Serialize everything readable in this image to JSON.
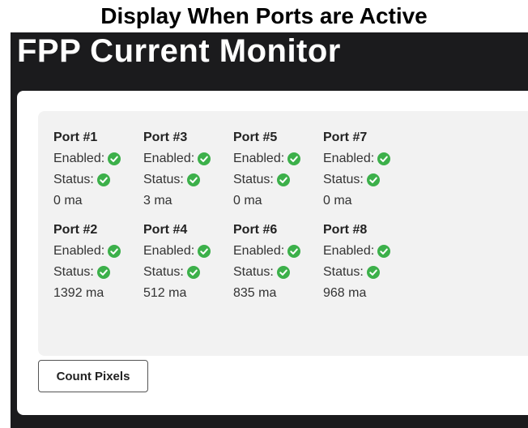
{
  "caption": "Display When Ports are Active",
  "app": {
    "title": "FPP Current Monitor"
  },
  "labels": {
    "enabled": "Enabled:",
    "status": "Status:"
  },
  "colors": {
    "check": "#3cb04a",
    "background": "#1b1b1d"
  },
  "icons": {
    "enabled": "check-circle-icon",
    "status": "check-circle-icon"
  },
  "ports": [
    {
      "name": "Port #1",
      "enabled": true,
      "status_ok": true,
      "current": "0 ma"
    },
    {
      "name": "Port #3",
      "enabled": true,
      "status_ok": true,
      "current": "3 ma"
    },
    {
      "name": "Port #5",
      "enabled": true,
      "status_ok": true,
      "current": "0 ma"
    },
    {
      "name": "Port #7",
      "enabled": true,
      "status_ok": true,
      "current": "0 ma"
    },
    {
      "name": "Port #2",
      "enabled": true,
      "status_ok": true,
      "current": "1392 ma"
    },
    {
      "name": "Port #4",
      "enabled": true,
      "status_ok": true,
      "current": "512 ma"
    },
    {
      "name": "Port #6",
      "enabled": true,
      "status_ok": true,
      "current": "835 ma"
    },
    {
      "name": "Port #8",
      "enabled": true,
      "status_ok": true,
      "current": "968 ma"
    }
  ],
  "buttons": {
    "count_pixels": "Count Pixels"
  }
}
